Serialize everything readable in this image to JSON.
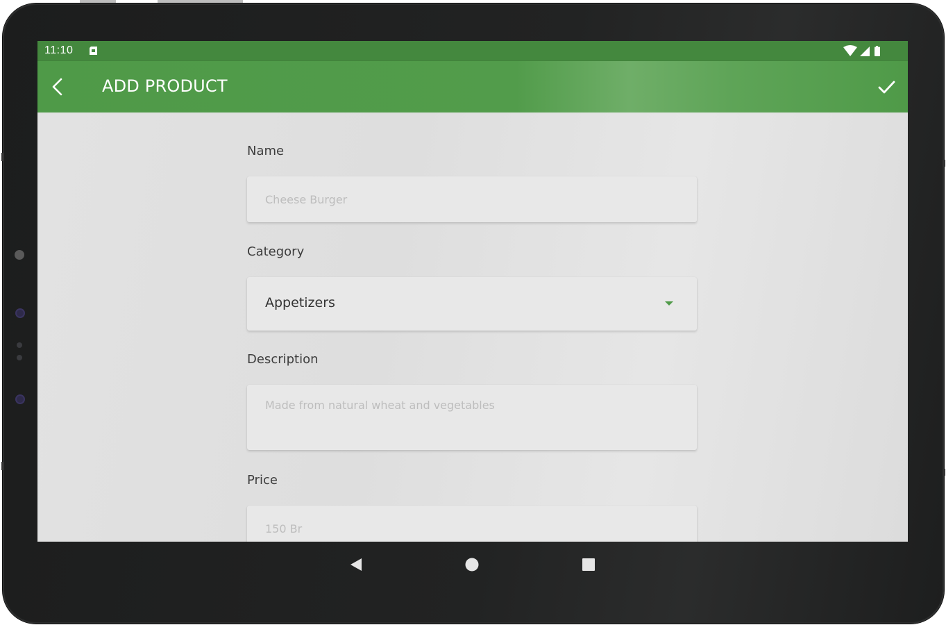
{
  "status_bar": {
    "time": "11:10",
    "icons": [
      "sd-card-icon",
      "wifi-icon",
      "signal-icon",
      "battery-icon"
    ]
  },
  "app_bar": {
    "title": "ADD PRODUCT",
    "back_icon": "back-arrow-icon",
    "save_icon": "checkmark-icon",
    "color": "#4f9a48"
  },
  "form": {
    "name": {
      "label": "Name",
      "placeholder": "Cheese Burger",
      "value": ""
    },
    "category": {
      "label": "Category",
      "selected": "Appetizers",
      "arrow_icon": "dropdown-arrow-icon"
    },
    "description": {
      "label": "Description",
      "placeholder": "Made from natural wheat and vegetables",
      "value": ""
    },
    "price": {
      "label": "Price",
      "placeholder": "150 Br",
      "value": ""
    }
  },
  "nav_bar": {
    "icons": [
      "nav-back-icon",
      "nav-home-icon",
      "nav-recents-icon"
    ]
  }
}
